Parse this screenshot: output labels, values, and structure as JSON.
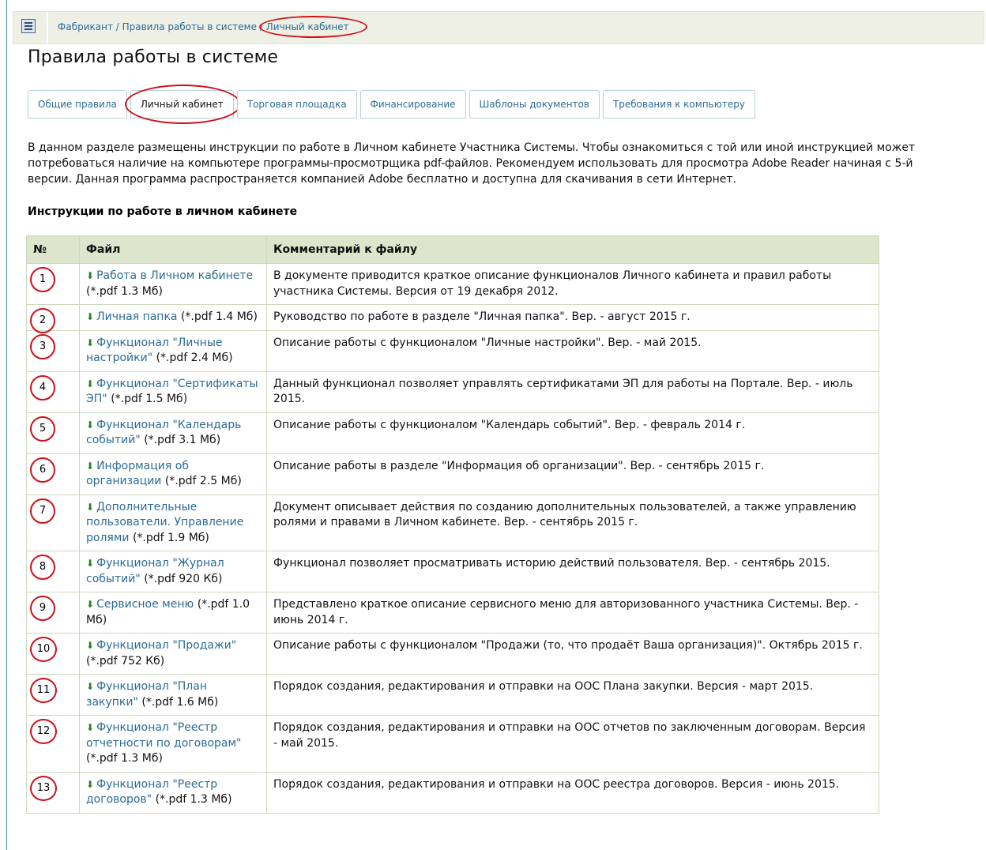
{
  "breadcrumb": {
    "items": [
      "Фабрикант",
      "Правила работы в системе",
      "Личный кабинет"
    ],
    "separator": " / "
  },
  "page_title": "Правила работы в системе",
  "tabs": [
    {
      "label": "Общие правила",
      "active": false
    },
    {
      "label": "Личный кабинет",
      "active": true
    },
    {
      "label": "Торговая площадка",
      "active": false
    },
    {
      "label": "Финансирование",
      "active": false
    },
    {
      "label": "Шаблоны документов",
      "active": false
    },
    {
      "label": "Требования к компьютеру",
      "active": false
    }
  ],
  "intro_text": "В данном разделе размещены инструкции по работе в Личном кабинете Участника Системы. Чтобы ознакомиться с той или иной инструкцией может потребоваться наличие на компьютере программы-просмотрщика pdf-файлов. Рекомендуем использовать для просмотра Adobe Reader начиная с 5-й версии. Данная программа распространяется компанией Adobe бесплатно и доступна для скачивания в сети Интернет.",
  "section_title": "Инструкции по работе в личном кабинете",
  "table": {
    "headers": [
      "№",
      "Файл",
      "Комментарий к файлу"
    ],
    "rows": [
      {
        "num": "1",
        "file": "Работа в Личном кабинете",
        "size": "(*.pdf 1.3 Мб)",
        "comment": "В документе приводится краткое описание функционалов Личного кабинета и правил работы участника Системы. Версия от 19 декабря 2012."
      },
      {
        "num": "2",
        "file": "Личная папка",
        "size": "(*.pdf 1.4 Мб)",
        "comment": "Руководство по работе в разделе \"Личная папка\". Вер. - август 2015 г."
      },
      {
        "num": "3",
        "file": "Функционал \"Личные настройки\"",
        "size": "(*.pdf 2.4 Мб)",
        "comment": "Описание работы с функционалом \"Личные настройки\". Вер. - май 2015."
      },
      {
        "num": "4",
        "file": "Функционал \"Сертификаты ЭП\"",
        "size": "(*.pdf 1.5 Мб)",
        "comment": "Данный функционал позволяет управлять сертификатами ЭП для работы на Портале. Вер. - июль 2015."
      },
      {
        "num": "5",
        "file": "Функционал \"Календарь событий\"",
        "size": "(*.pdf 3.1 Мб)",
        "comment": "Описание работы с функционалом \"Календарь событий\". Вер. - февраль 2014 г."
      },
      {
        "num": "6",
        "file": "Информация об организации",
        "size": "(*.pdf 2.5 Мб)",
        "comment": "Описание работы в разделе \"Информация об организации\". Вер. - сентябрь 2015 г."
      },
      {
        "num": "7",
        "file": "Дополнительные пользователи. Управление ролями",
        "size": "(*.pdf 1.9 Мб)",
        "comment": "Документ описывает действия по созданию дополнительных пользователей, а также управлению ролями и правами в Личном кабинете. Вер. - сентябрь 2015 г."
      },
      {
        "num": "8",
        "file": "Функционал \"Журнал событий\"",
        "size": "(*.pdf 920 Кб)",
        "comment": "Функционал позволяет просматривать историю действий пользователя. Вер. - сентябрь 2015."
      },
      {
        "num": "9",
        "file": "Сервисное меню",
        "size": "(*.pdf 1.0 Мб)",
        "comment": "Представлено краткое описание сервисного меню для авторизованного участника Системы. Вер. - июнь 2014 г."
      },
      {
        "num": "10",
        "file": "Функционал \"Продажи\"",
        "size": "(*.pdf 752 Кб)",
        "comment": "Описание работы с функционалом \"Продажи (то, что продаёт Ваша организация)\". Октябрь 2015 г."
      },
      {
        "num": "11",
        "file": "Функционал \"План закупки\"",
        "size": "(*.pdf 1.6 Мб)",
        "comment": "Порядок создания, редактирования и отправки на ООС Плана закупки. Версия - март 2015."
      },
      {
        "num": "12",
        "file": "Функционал \"Реестр отчетности по договорам\"",
        "size": "(*.pdf 1.3 Мб)",
        "comment": "Порядок создания, редактирования и отправки на ООС отчетов по заключенным договорам. Версия - май 2015."
      },
      {
        "num": "13",
        "file": "Функционал \"Реестр договоров\"",
        "size": "(*.pdf 1.3 Мб)",
        "comment": "Порядок создания, редактирования и отправки на ООС реестра договоров. Версия - июнь 2015."
      }
    ]
  },
  "colors": {
    "link": "#2b6b96",
    "header_bg": "#dde5cd",
    "annotation_red": "#d0101b",
    "topbar_bg": "#eef0e6"
  },
  "icons": {
    "menu": "menu-icon",
    "download": "download-arrow-icon"
  }
}
